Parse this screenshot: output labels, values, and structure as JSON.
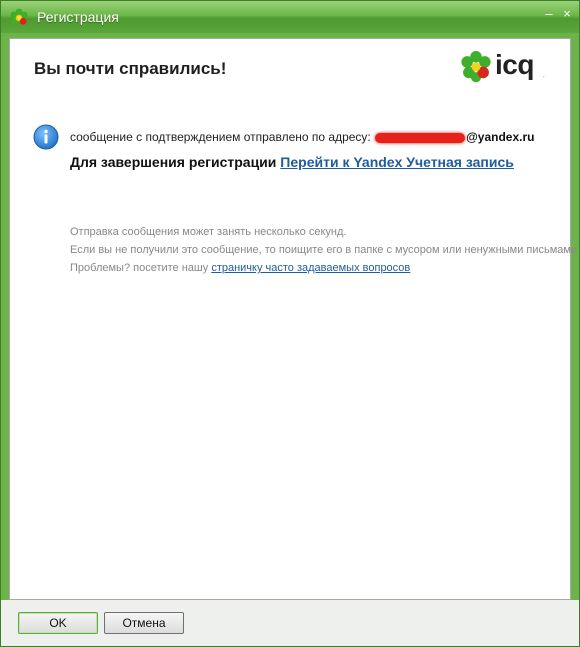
{
  "window": {
    "title": "Регистрация",
    "minimize_glyph": "–",
    "close_glyph": "×"
  },
  "header": {
    "heading": "Вы почти справились!",
    "brand_text": "icq",
    "brand_dot": "."
  },
  "message": {
    "line1_prefix": "сообщение с подтверждением отправлено по адресу:",
    "email_domain": "@yandex.ru",
    "line2_prefix": "Для завершения регистрации",
    "line2_link": "Перейти к Yandex Учетная запись"
  },
  "notes": {
    "line1": "Отправка сообщения может занять несколько секунд.",
    "line2": "Если вы не получили это сообщение, то поищите его в папке с мусором или ненужными письмами",
    "line3_prefix": "Проблемы? посетите нашу",
    "line3_link": "страничку часто задаваемых вопросов"
  },
  "buttons": {
    "ok_label": "OK",
    "cancel_label": "Отмена"
  },
  "icons": {
    "title_icon": "icq-flower-icon",
    "brand_icon": "icq-flower-icon",
    "info_icon": "info-icon"
  },
  "colors": {
    "title_bar": "#5aa73a",
    "link": "#1e5c9e",
    "redaction": "#e8221a",
    "info_blue": "#2a7fd4"
  }
}
